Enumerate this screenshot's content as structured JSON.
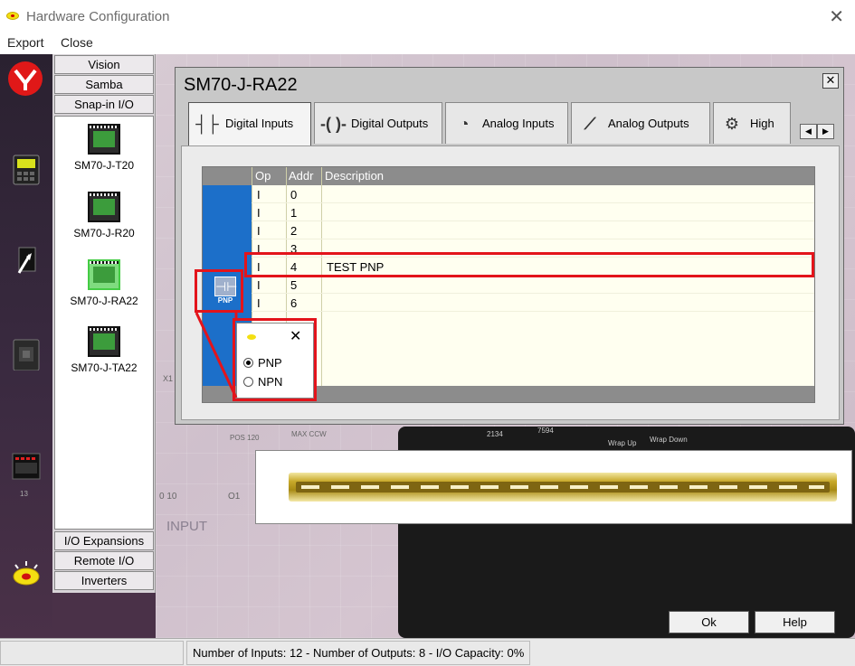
{
  "window": {
    "title": "Hardware Configuration"
  },
  "menu": [
    "Export",
    "Close"
  ],
  "left_icons": [
    "logo-icon",
    "hmi-panel-icon",
    "cable-icon",
    "controller-icon",
    "io-module-icon",
    "alarm-icon"
  ],
  "left_icon_caption": "13",
  "categories": {
    "top": [
      "Vision",
      "Samba",
      "Snap-in I/O"
    ],
    "bottom": [
      "I/O Expansions",
      "Remote I/O",
      "Inverters"
    ]
  },
  "modules": [
    {
      "label": "SM70-J-T20"
    },
    {
      "label": "SM70-J-R20"
    },
    {
      "label": "SM70-J-RA22",
      "selected": true
    },
    {
      "label": "SM70-J-TA22"
    }
  ],
  "dialog": {
    "title": "SM70-J-RA22",
    "tabs": [
      {
        "label": "Digital Inputs",
        "active": true
      },
      {
        "label": "Digital Outputs"
      },
      {
        "label": "Analog Inputs"
      },
      {
        "label": "Analog Outputs"
      },
      {
        "label": "High"
      }
    ],
    "columns": {
      "op": "Op",
      "addr": "Addr",
      "desc": "Description"
    },
    "rows": [
      {
        "op": "I",
        "addr": "0",
        "desc": ""
      },
      {
        "op": "I",
        "addr": "1",
        "desc": ""
      },
      {
        "op": "I",
        "addr": "2",
        "desc": ""
      },
      {
        "op": "I",
        "addr": "3",
        "desc": ""
      },
      {
        "op": "I",
        "addr": "4",
        "desc": "TEST PNP"
      },
      {
        "op": "I",
        "addr": "5",
        "desc": ""
      },
      {
        "op": "I",
        "addr": "6",
        "desc": ""
      }
    ],
    "badge_label": "PNP"
  },
  "popup": {
    "options": [
      "PNP",
      "NPN"
    ],
    "selected": "PNP"
  },
  "background_text": {
    "pos": "POS 120",
    "maxccw": "MAX CCW",
    "num1": "2134",
    "num2": "7594",
    "wrap_up": "Wrap Up",
    "wrap_down": "Wrap Down",
    "x1": "X1",
    "ten": "0 10",
    "o1": "O1",
    "input": "INPUT"
  },
  "buttons": {
    "ok": "Ok",
    "help": "Help"
  },
  "status": "Number of Inputs: 12  -  Number of Outputs: 8  -  I/O Capacity: 0%",
  "colors": {
    "highlight": "#e3141b",
    "grid_side": "#1c6fc9",
    "grid_bg": "#fffff0"
  }
}
